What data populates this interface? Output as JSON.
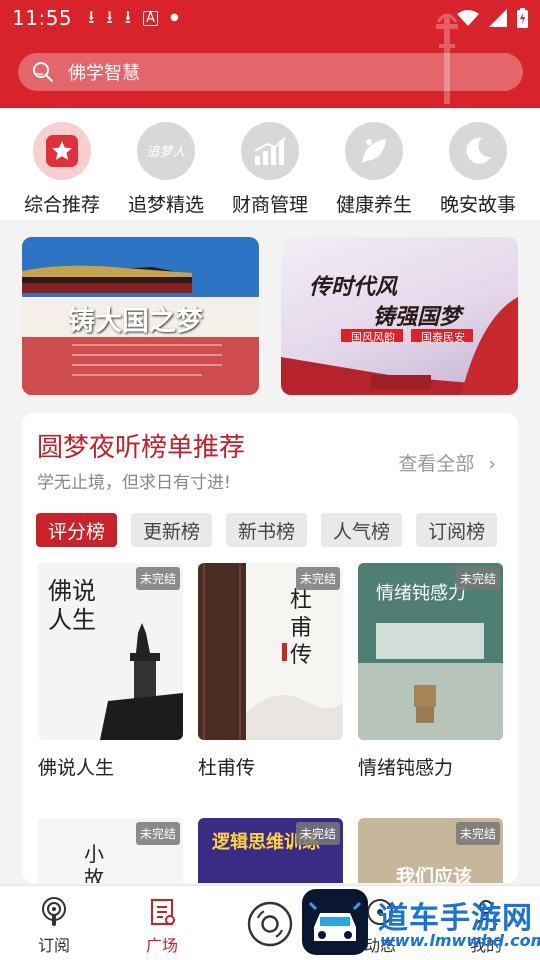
{
  "status_bar": {
    "time": "11:55"
  },
  "search": {
    "placeholder": "佛学智慧"
  },
  "categories": [
    {
      "label": "综合推荐",
      "icon": "star-icon"
    },
    {
      "label": "追梦精选",
      "icon": "dream-icon"
    },
    {
      "label": "财商管理",
      "icon": "bar-chart-icon"
    },
    {
      "label": "健康养生",
      "icon": "leaf-icon"
    },
    {
      "label": "晚安故事",
      "icon": "moon-icon"
    }
  ],
  "banners": [
    {
      "title": "铸大国之梦"
    },
    {
      "title_line1": "传时代风",
      "title_line2": "铸强国梦",
      "tag1": "国风风韵",
      "tag2": "国泰民安"
    }
  ],
  "ranking": {
    "title": "圆梦夜听榜单推荐",
    "subtitle": "学无止境，但求日有寸进!",
    "view_all": "查看全部",
    "tabs": [
      "评分榜",
      "更新榜",
      "新书榜",
      "人气榜",
      "订阅榜"
    ],
    "books": [
      {
        "title": "佛说人生",
        "badge": "未完结",
        "cover_text": "佛说人生"
      },
      {
        "title": "杜甫传",
        "badge": "未完结",
        "cover_text": "杜甫传"
      },
      {
        "title": "情绪钝感力",
        "badge": "未完结",
        "cover_text": "情绪钝感力"
      },
      {
        "title": "",
        "badge": "未完结",
        "cover_text": "小故事"
      },
      {
        "title": "",
        "badge": "未完结",
        "cover_text": "逻辑思维训练"
      },
      {
        "title": "",
        "badge": "未完结",
        "cover_text": "我们应该"
      }
    ]
  },
  "bottom_nav": [
    {
      "label": "订阅",
      "icon": "podcast-icon"
    },
    {
      "label": "广场",
      "icon": "square-list-icon"
    },
    {
      "label": "",
      "icon": "disc-icon"
    },
    {
      "label": "动态",
      "icon": "dynamic-icon"
    },
    {
      "label": "我的",
      "icon": "profile-icon"
    }
  ],
  "watermark": {
    "text": "道车手游网",
    "url": "www.lmwwbd.com"
  },
  "colors": {
    "brand_red": "#d8232a",
    "tab_active": "#c9222a"
  }
}
